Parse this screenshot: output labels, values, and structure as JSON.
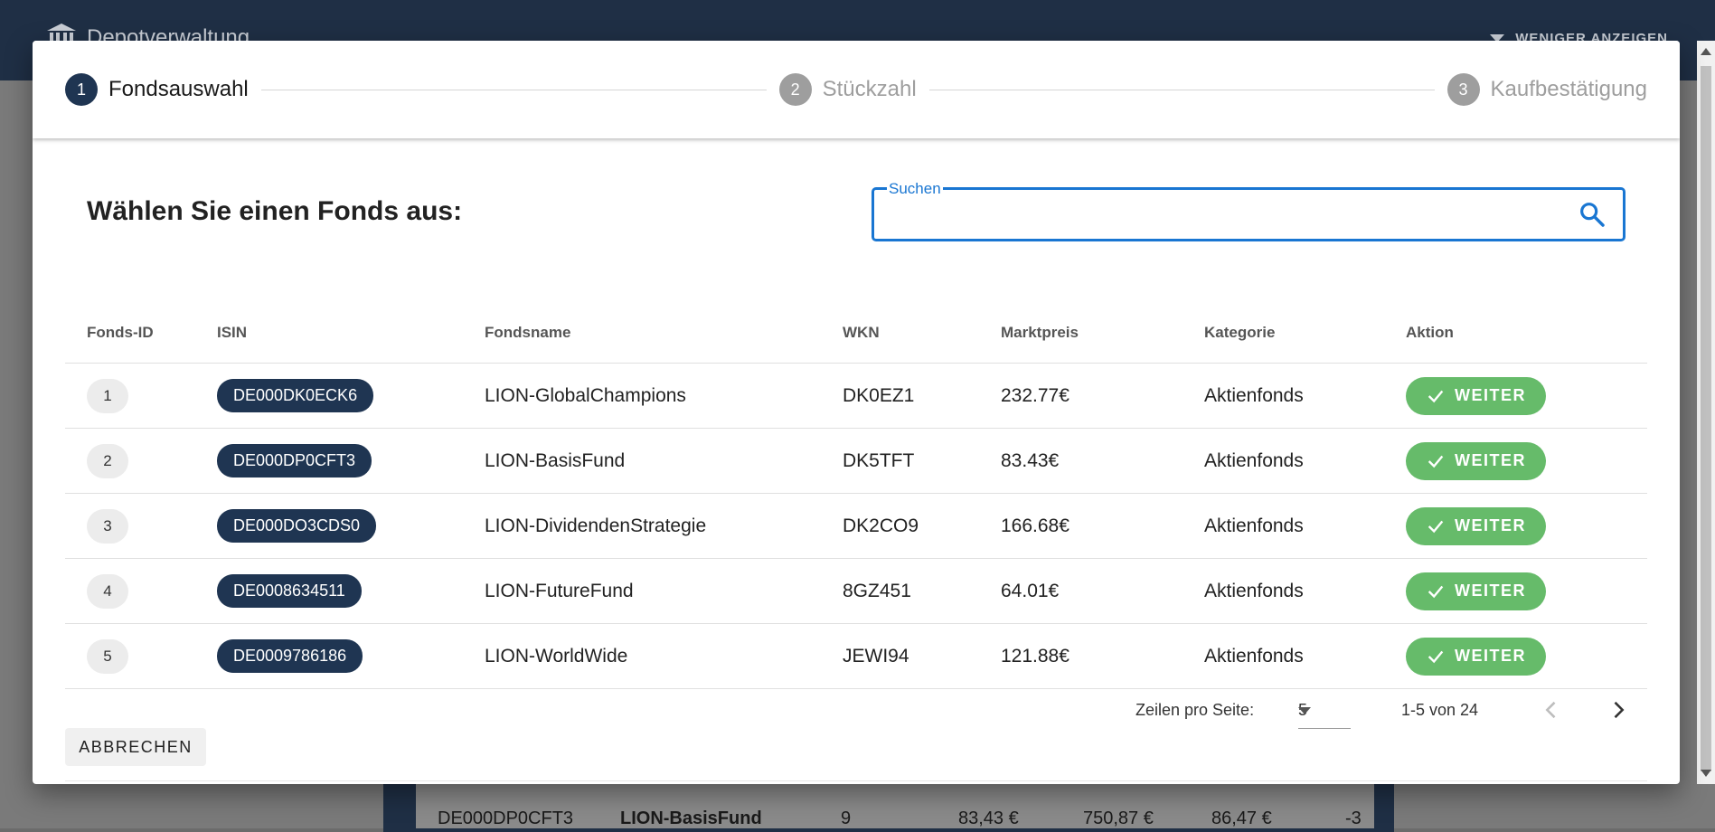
{
  "app": {
    "title": "Depotverwaltung",
    "toggle_label": "WENIGER ANZEIGEN"
  },
  "background_row": {
    "isin": "DE000DP0CFT3",
    "name": "LION-BasisFund",
    "qty": "9",
    "price": "83,43 €",
    "value": "750,87 €",
    "other": "86,47 €",
    "diff": "-3"
  },
  "stepper": {
    "steps": [
      {
        "number": "1",
        "label": "Fondsauswahl",
        "state": "active"
      },
      {
        "number": "2",
        "label": "Stückzahl",
        "state": "inactive"
      },
      {
        "number": "3",
        "label": "Kaufbestätigung",
        "state": "inactive"
      }
    ]
  },
  "dialog": {
    "heading": "Wählen Sie einen Fonds aus:",
    "search": {
      "label": "Suchen",
      "value": ""
    },
    "columns": [
      "Fonds-ID",
      "ISIN",
      "Fondsname",
      "WKN",
      "Marktpreis",
      "Kategorie",
      "Aktion"
    ],
    "rows": [
      {
        "id": "1",
        "isin": "DE000DK0ECK6",
        "name": "LION-GlobalChampions",
        "wkn": "DK0EZ1",
        "price": "232.77€",
        "category": "Aktienfonds",
        "action": "WEITER"
      },
      {
        "id": "2",
        "isin": "DE000DP0CFT3",
        "name": "LION-BasisFund",
        "wkn": "DK5TFT",
        "price": "83.43€",
        "category": "Aktienfonds",
        "action": "WEITER"
      },
      {
        "id": "3",
        "isin": "DE000DO3CDS0",
        "name": "LION-DividendenStrategie",
        "wkn": "DK2CO9",
        "price": "166.68€",
        "category": "Aktienfonds",
        "action": "WEITER"
      },
      {
        "id": "4",
        "isin": "DE0008634511",
        "name": "LION-FutureFund",
        "wkn": "8GZ451",
        "price": "64.01€",
        "category": "Aktienfonds",
        "action": "WEITER"
      },
      {
        "id": "5",
        "isin": "DE0009786186",
        "name": "LION-WorldWide",
        "wkn": "JEWI94",
        "price": "121.88€",
        "category": "Aktienfonds",
        "action": "WEITER"
      }
    ],
    "pagination": {
      "rows_per_page_label": "Zeilen pro Seite:",
      "rows_per_page": "5",
      "range": "1-5 von 24"
    },
    "cancel_label": "ABBRECHEN"
  },
  "colors": {
    "primary": "#1f3552",
    "success": "#66bb6a",
    "focus": "#1976d2",
    "inactive": "#9e9e9e"
  }
}
